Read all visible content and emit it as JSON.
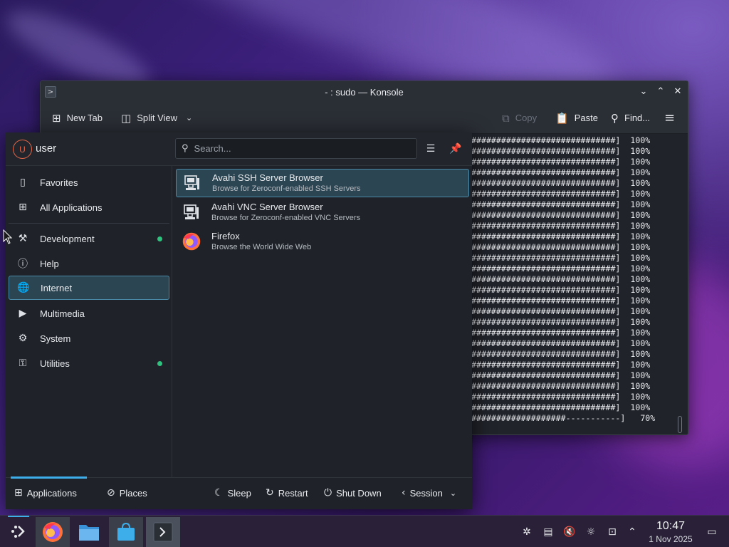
{
  "konsole": {
    "title": "- : sudo — Konsole",
    "app_icon": ">",
    "toolbar": {
      "new_tab": "New Tab",
      "split_view": "Split View",
      "copy": "Copy",
      "paste": "Paste",
      "find": "Find..."
    },
    "terminal_lines": [
      "#############################]  100%",
      "#############################]  100%",
      "#############################]  100%",
      "#############################]  100%",
      "#############################]  100%",
      "#############################]  100%",
      "#############################]  100%",
      "#############################]  100%",
      "#############################]  100%",
      "#############################]  100%",
      "#############################]  100%",
      "#############################]  100%",
      "#############################]  100%",
      "#############################]  100%",
      "#############################]  100%",
      "#############################]  100%",
      "#############################]  100%",
      "#############################]  100%",
      "#############################]  100%",
      "#############################]  100%",
      "#############################]  100%",
      "#############################]  100%",
      "#############################]  100%",
      "#############################]  100%",
      "#############################]  100%",
      "#############################]  100%",
      "###################-----------]   70%"
    ]
  },
  "launcher": {
    "avatar_initial": "U",
    "username": "user",
    "search_placeholder": "Search...",
    "categories": [
      {
        "label": "Favorites",
        "icon": "bookmark-icon"
      },
      {
        "label": "All Applications",
        "icon": "grid-icon"
      },
      {
        "label": "Development",
        "icon": "hammer-icon",
        "new": true
      },
      {
        "label": "Help",
        "icon": "info-icon"
      },
      {
        "label": "Internet",
        "icon": "globe-icon",
        "active": true
      },
      {
        "label": "Multimedia",
        "icon": "monitor-play-icon"
      },
      {
        "label": "System",
        "icon": "gear-icon"
      },
      {
        "label": "Utilities",
        "icon": "toolbox-icon",
        "new": true
      }
    ],
    "apps": [
      {
        "name": "Avahi SSH Server Browser",
        "desc": "Browse for Zeroconf-enabled SSH Servers",
        "icon": "network-computer-icon"
      },
      {
        "name": "Avahi VNC Server Browser",
        "desc": "Browse for Zeroconf-enabled VNC Servers",
        "icon": "network-computer-icon"
      },
      {
        "name": "Firefox",
        "desc": "Browse the World Wide Web",
        "icon": "firefox-icon"
      }
    ],
    "footer": {
      "applications": "Applications",
      "places": "Places",
      "sleep": "Sleep",
      "restart": "Restart",
      "shutdown": "Shut Down",
      "session": "Session"
    }
  },
  "taskbar": {
    "time": "10:47",
    "date": "1 Nov 2025"
  },
  "colors": {
    "accent": "#3daee9",
    "new_indicator": "#2ec27e",
    "selection": "#2b4552"
  }
}
